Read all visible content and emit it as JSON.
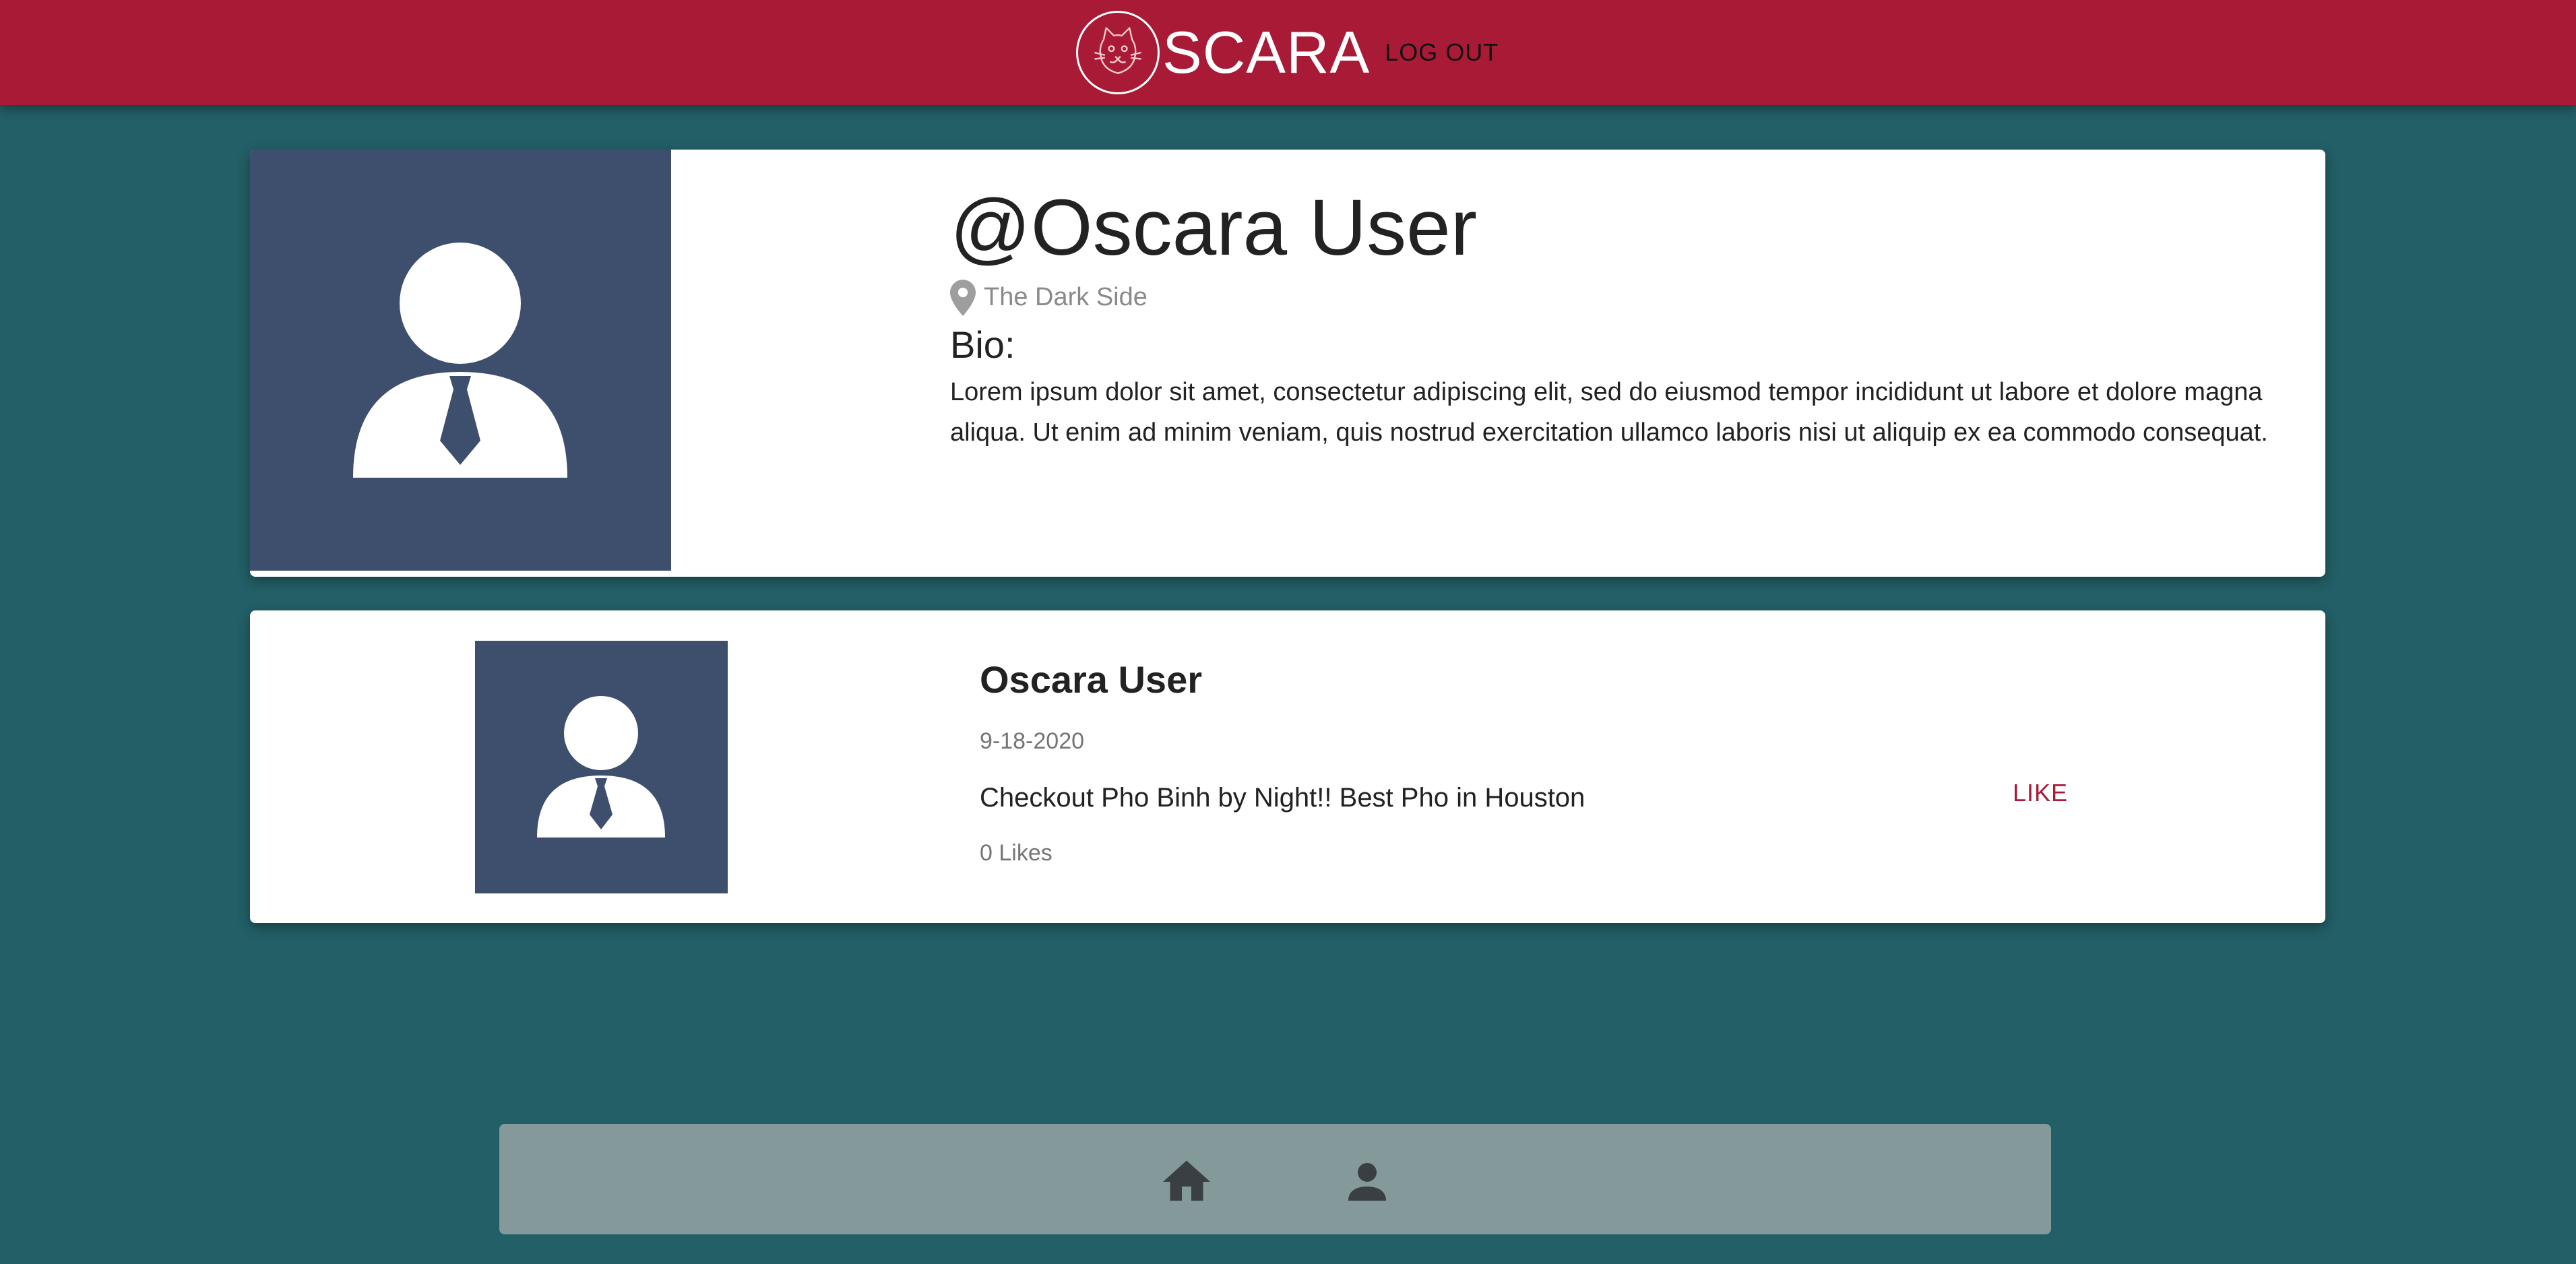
{
  "header": {
    "brand_name": "SCARA",
    "logout_label": "LOG OUT",
    "logo_icon": "oscara-cat-logo",
    "background_color": "#a91a36"
  },
  "profile": {
    "username": "@Oscara User",
    "location": "The Dark Side",
    "location_icon": "map-pin-icon",
    "bio_label": "Bio:",
    "bio_text": "Lorem ipsum dolor sit amet, consectetur adipiscing elit, sed do eiusmod tempor incididunt ut labore et dolore magna aliqua. Ut enim ad minim veniam, quis nostrud exercitation ullamco laboris nisi ut aliquip ex ea commodo consequat.",
    "avatar_icon": "user-avatar-icon"
  },
  "posts": [
    {
      "author": "Oscara User",
      "date": "9-18-2020",
      "text": "Checkout Pho Binh by Night!! Best Pho in Houston",
      "likes_text": "0 Likes",
      "like_label": "LIKE",
      "avatar_icon": "user-avatar-icon"
    }
  ],
  "bottom_nav": {
    "items": [
      {
        "icon": "home-icon"
      },
      {
        "icon": "person-icon"
      }
    ]
  },
  "colors": {
    "page_background": "#225f66",
    "avatar_background": "#3e4f6e",
    "accent": "#a91a36",
    "nav_background": "#84999a"
  }
}
